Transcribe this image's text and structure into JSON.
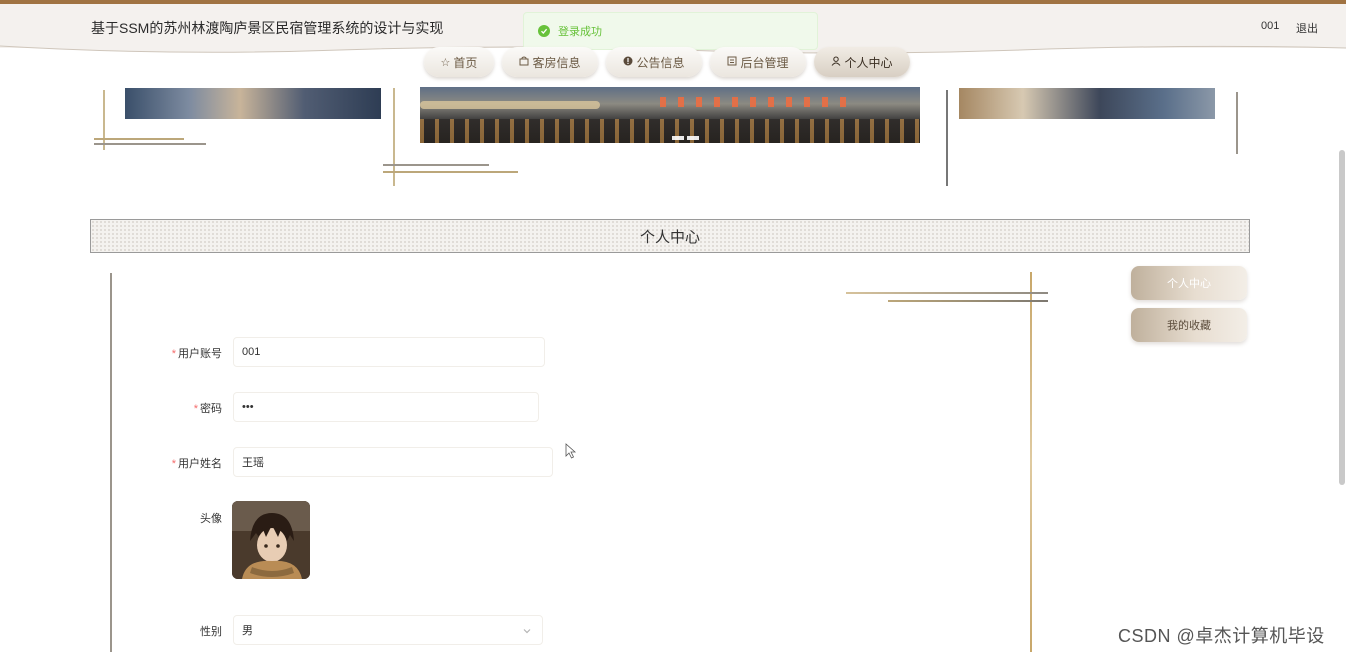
{
  "header": {
    "title": "基于SSM的苏州林渡陶庐景区民宿管理系统的设计与实现",
    "user": "001",
    "logout": "退出"
  },
  "toast": {
    "message": "登录成功",
    "type": "success",
    "color": "#67c23a"
  },
  "nav": {
    "items": [
      {
        "label": "首页",
        "icon": "star-icon"
      },
      {
        "label": "客房信息",
        "icon": "bag-icon"
      },
      {
        "label": "公告信息",
        "icon": "info-icon"
      },
      {
        "label": "后台管理",
        "icon": "building-icon"
      },
      {
        "label": "个人中心",
        "icon": "user-icon",
        "active": true
      }
    ]
  },
  "section": {
    "title": "个人中心"
  },
  "form": {
    "username": {
      "label": "用户账号",
      "required": true,
      "value": "001"
    },
    "password": {
      "label": "密码",
      "required": true,
      "value": "•••"
    },
    "name": {
      "label": "用户姓名",
      "required": true,
      "value": "王瑶"
    },
    "avatar": {
      "label": "头像"
    },
    "gender": {
      "label": "性别",
      "value": "男"
    }
  },
  "sidebar": {
    "items": [
      {
        "label": "个人中心"
      },
      {
        "label": "我的收藏"
      }
    ]
  },
  "watermark": "CSDN @卓杰计算机毕设",
  "colors": {
    "accent": "#a07342",
    "success": "#67c23a",
    "required": "#f56c6c"
  }
}
